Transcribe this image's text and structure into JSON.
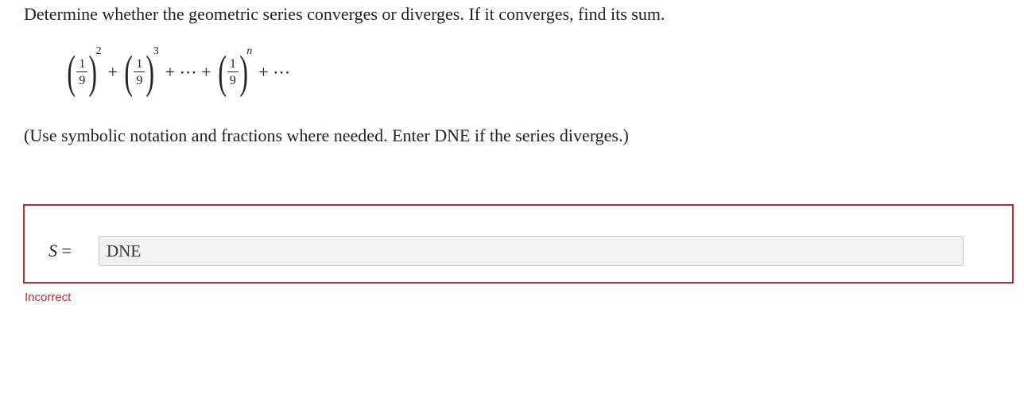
{
  "question": {
    "prompt": "Determine whether the geometric series converges or diverges. If it converges, find its sum.",
    "note": "(Use symbolic notation and fractions where needed. Enter DNE if the series diverges.)"
  },
  "series": {
    "terms": [
      {
        "numerator": "1",
        "denominator": "9",
        "exponent": "2"
      },
      {
        "numerator": "1",
        "denominator": "9",
        "exponent": "3"
      },
      {
        "numerator": "1",
        "denominator": "9",
        "exponent": "n"
      }
    ],
    "plus": "+",
    "ellipsis_plus": "+ ⋯ +",
    "trailing": "+ ⋯"
  },
  "answer": {
    "label_var": "S",
    "label_eq": "=",
    "value": "DNE",
    "feedback": "Incorrect",
    "error_color": "#c0282d"
  }
}
